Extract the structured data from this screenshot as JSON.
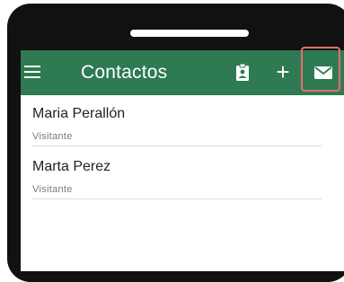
{
  "app": {
    "title": "Contactos",
    "colors": {
      "appbar": "#2e7a53",
      "highlight": "#f06a6a",
      "phone_frame": "#111111"
    }
  },
  "appbar": {
    "menu_icon": "hamburger-menu-icon",
    "actions": [
      {
        "icon": "contact-badge-icon"
      },
      {
        "icon": "add-icon",
        "glyph": "+"
      },
      {
        "icon": "mail-icon"
      }
    ]
  },
  "contacts": [
    {
      "name": "Maria Perallón",
      "role": "Visitante"
    },
    {
      "name": "Marta Perez",
      "role": "Visitante"
    }
  ]
}
